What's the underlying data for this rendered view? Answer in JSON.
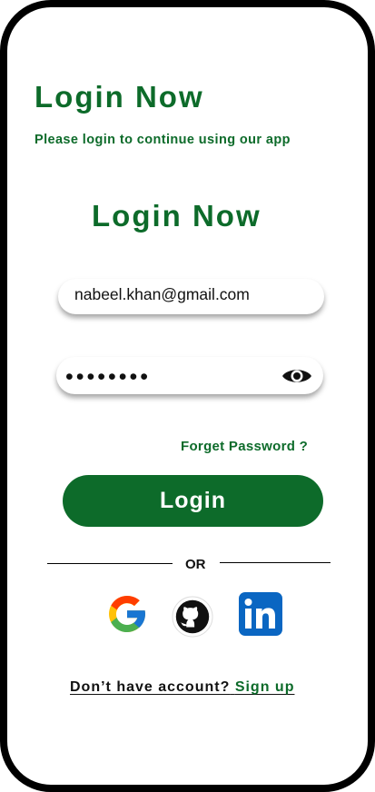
{
  "header": {
    "title": "Login Now",
    "subtitle": "Please login to continue using our app"
  },
  "form": {
    "heading": "Login Now",
    "email_value": "nabeel.khan@gmail.com",
    "password_mask": "••••••••",
    "password_visibility_icon": "eye-icon",
    "forgot_password": "Forget Password ?",
    "login_button": "Login"
  },
  "social": {
    "or_text": "OR",
    "providers": [
      "google-icon",
      "github-icon",
      "linkedin-icon"
    ]
  },
  "footer": {
    "prompt": "Don’t have account?",
    "signup_link": "Sign up"
  },
  "colors": {
    "brand_green": "#0d6b2a",
    "linkedin_blue": "#0a66c2"
  }
}
